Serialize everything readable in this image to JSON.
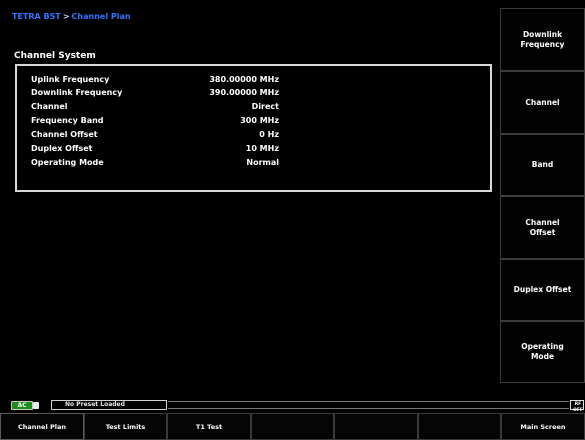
{
  "breadcrumb": {
    "root": "TETRA BST",
    "separator": ">",
    "current": "Channel Plan"
  },
  "section": {
    "title": "Channel System"
  },
  "channel_params": [
    {
      "label": "Uplink Frequency",
      "value": "380.00000 MHz"
    },
    {
      "label": "Downlink Frequency",
      "value": "390.00000 MHz"
    },
    {
      "label": "Channel",
      "value": "Direct"
    },
    {
      "label": "Frequency Band",
      "value": "300 MHz"
    },
    {
      "label": "Channel Offset",
      "value": "0 Hz"
    },
    {
      "label": "Duplex Offset",
      "value": "10 MHz"
    },
    {
      "label": "Operating Mode",
      "value": "Normal"
    }
  ],
  "side_keys": [
    {
      "label": "Downlink\nFrequency"
    },
    {
      "label": "Channel"
    },
    {
      "label": "Band"
    },
    {
      "label": "Channel\nOffset"
    },
    {
      "label": "Duplex Offset"
    },
    {
      "label": "Operating\nMode"
    }
  ],
  "status": {
    "power_label": "AC",
    "preset_text": "No Preset Loaded",
    "rf_text": "RF OFF"
  },
  "bottom_keys": [
    {
      "label": "Channel Plan"
    },
    {
      "label": "Test Limits"
    },
    {
      "label": "T1 Test"
    },
    {
      "label": ""
    },
    {
      "label": ""
    },
    {
      "label": ""
    },
    {
      "label": "Main Screen"
    }
  ],
  "colors": {
    "accent": "#2f74ff",
    "power_badge": "#1a8d1a",
    "background": "#000000"
  }
}
